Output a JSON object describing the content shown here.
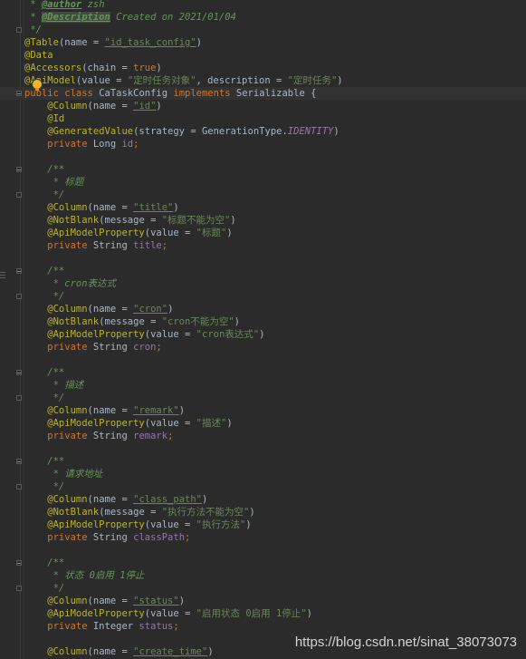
{
  "editor": {
    "lines": [
      {
        "fold": "",
        "current": false,
        "tokens": [
          {
            "t": " * ",
            "c": "c-comment"
          },
          {
            "t": "@author",
            "c": "c-tag"
          },
          {
            "t": " zsh",
            "c": "c-comment"
          }
        ]
      },
      {
        "fold": "",
        "current": false,
        "tokens": [
          {
            "t": " * ",
            "c": "c-comment"
          },
          {
            "t": "@Description",
            "c": "c-tag c-tag-hl"
          },
          {
            "t": " Created on 2021/01/04",
            "c": "c-comment"
          }
        ]
      },
      {
        "fold": "close",
        "current": false,
        "tokens": [
          {
            "t": " */",
            "c": "c-comment"
          }
        ]
      },
      {
        "fold": "",
        "current": false,
        "tokens": [
          {
            "t": "@Table",
            "c": "c-anno"
          },
          {
            "t": "(name = ",
            "c": "c-plain"
          },
          {
            "t": "\"id_task_config\"",
            "c": "c-str-u"
          },
          {
            "t": ")",
            "c": "c-plain"
          }
        ]
      },
      {
        "fold": "",
        "current": false,
        "tokens": [
          {
            "t": "@Data",
            "c": "c-anno"
          }
        ]
      },
      {
        "fold": "",
        "current": false,
        "tokens": [
          {
            "t": "@Accessors",
            "c": "c-anno"
          },
          {
            "t": "(chain = ",
            "c": "c-plain"
          },
          {
            "t": "true",
            "c": "c-kw"
          },
          {
            "t": ")",
            "c": "c-plain"
          }
        ]
      },
      {
        "fold": "",
        "current": false,
        "tokens": [
          {
            "t": "@ApiModel",
            "c": "c-anno"
          },
          {
            "t": "(value = ",
            "c": "c-plain"
          },
          {
            "t": "\"定时任务对象\"",
            "c": "c-str"
          },
          {
            "t": ", description = ",
            "c": "c-plain"
          },
          {
            "t": "\"定时任务\"",
            "c": "c-str"
          },
          {
            "t": ")",
            "c": "c-plain"
          }
        ]
      },
      {
        "fold": "open",
        "current": true,
        "tokens": [
          {
            "t": "public class ",
            "c": "c-kw"
          },
          {
            "t": "CaTaskConfig",
            "c": "c-cls"
          },
          {
            "t": " implements ",
            "c": "c-kw"
          },
          {
            "t": "Serializable {",
            "c": "c-plain"
          }
        ]
      },
      {
        "fold": "",
        "current": false,
        "tokens": [
          {
            "t": "    @Column",
            "c": "c-anno"
          },
          {
            "t": "(name = ",
            "c": "c-plain"
          },
          {
            "t": "\"id\"",
            "c": "c-str-u"
          },
          {
            "t": ")",
            "c": "c-plain"
          }
        ]
      },
      {
        "fold": "",
        "current": false,
        "tokens": [
          {
            "t": "    @Id",
            "c": "c-anno"
          }
        ]
      },
      {
        "fold": "",
        "current": false,
        "tokens": [
          {
            "t": "    @GeneratedValue",
            "c": "c-anno"
          },
          {
            "t": "(strategy = GenerationType.",
            "c": "c-plain"
          },
          {
            "t": "IDENTITY",
            "c": "c-const"
          },
          {
            "t": ")",
            "c": "c-plain"
          }
        ]
      },
      {
        "fold": "",
        "current": false,
        "tokens": [
          {
            "t": "    private ",
            "c": "c-kw"
          },
          {
            "t": "Long ",
            "c": "c-plain"
          },
          {
            "t": "id",
            "c": "c-field"
          },
          {
            "t": ";",
            "c": "c-kw"
          }
        ]
      },
      {
        "fold": "",
        "current": false,
        "tokens": []
      },
      {
        "fold": "open",
        "current": false,
        "tokens": [
          {
            "t": "    /**",
            "c": "c-comment"
          }
        ]
      },
      {
        "fold": "",
        "current": false,
        "tokens": [
          {
            "t": "     * 标题",
            "c": "c-comment"
          }
        ]
      },
      {
        "fold": "close",
        "current": false,
        "tokens": [
          {
            "t": "     */",
            "c": "c-comment"
          }
        ]
      },
      {
        "fold": "",
        "current": false,
        "tokens": [
          {
            "t": "    @Column",
            "c": "c-anno"
          },
          {
            "t": "(name = ",
            "c": "c-plain"
          },
          {
            "t": "\"title\"",
            "c": "c-str-u"
          },
          {
            "t": ")",
            "c": "c-plain"
          }
        ]
      },
      {
        "fold": "",
        "current": false,
        "tokens": [
          {
            "t": "    @NotBlank",
            "c": "c-anno"
          },
          {
            "t": "(message = ",
            "c": "c-plain"
          },
          {
            "t": "\"标题不能为空\"",
            "c": "c-str"
          },
          {
            "t": ")",
            "c": "c-plain"
          }
        ]
      },
      {
        "fold": "",
        "current": false,
        "tokens": [
          {
            "t": "    @ApiModelProperty",
            "c": "c-anno"
          },
          {
            "t": "(value = ",
            "c": "c-plain"
          },
          {
            "t": "\"标题\"",
            "c": "c-str"
          },
          {
            "t": ")",
            "c": "c-plain"
          }
        ]
      },
      {
        "fold": "",
        "current": false,
        "tokens": [
          {
            "t": "    private ",
            "c": "c-kw"
          },
          {
            "t": "String ",
            "c": "c-plain"
          },
          {
            "t": "title",
            "c": "c-field"
          },
          {
            "t": ";",
            "c": "c-kw"
          }
        ]
      },
      {
        "fold": "",
        "current": false,
        "tokens": []
      },
      {
        "fold": "open",
        "current": false,
        "tokens": [
          {
            "t": "    /**",
            "c": "c-comment"
          }
        ]
      },
      {
        "fold": "",
        "current": false,
        "tokens": [
          {
            "t": "     * cron表达式",
            "c": "c-comment"
          }
        ]
      },
      {
        "fold": "close",
        "current": false,
        "tokens": [
          {
            "t": "     */",
            "c": "c-comment"
          }
        ]
      },
      {
        "fold": "",
        "current": false,
        "tokens": [
          {
            "t": "    @Column",
            "c": "c-anno"
          },
          {
            "t": "(name = ",
            "c": "c-plain"
          },
          {
            "t": "\"cron\"",
            "c": "c-str-u"
          },
          {
            "t": ")",
            "c": "c-plain"
          }
        ]
      },
      {
        "fold": "",
        "current": false,
        "tokens": [
          {
            "t": "    @NotBlank",
            "c": "c-anno"
          },
          {
            "t": "(message = ",
            "c": "c-plain"
          },
          {
            "t": "\"cron不能为空\"",
            "c": "c-str"
          },
          {
            "t": ")",
            "c": "c-plain"
          }
        ]
      },
      {
        "fold": "",
        "current": false,
        "tokens": [
          {
            "t": "    @ApiModelProperty",
            "c": "c-anno"
          },
          {
            "t": "(value = ",
            "c": "c-plain"
          },
          {
            "t": "\"cron表达式\"",
            "c": "c-str"
          },
          {
            "t": ")",
            "c": "c-plain"
          }
        ]
      },
      {
        "fold": "",
        "current": false,
        "tokens": [
          {
            "t": "    private ",
            "c": "c-kw"
          },
          {
            "t": "String ",
            "c": "c-plain"
          },
          {
            "t": "cron",
            "c": "c-field"
          },
          {
            "t": ";",
            "c": "c-kw"
          }
        ]
      },
      {
        "fold": "",
        "current": false,
        "tokens": []
      },
      {
        "fold": "open",
        "current": false,
        "tokens": [
          {
            "t": "    /**",
            "c": "c-comment"
          }
        ]
      },
      {
        "fold": "",
        "current": false,
        "tokens": [
          {
            "t": "     * 描述",
            "c": "c-comment"
          }
        ]
      },
      {
        "fold": "close",
        "current": false,
        "tokens": [
          {
            "t": "     */",
            "c": "c-comment"
          }
        ]
      },
      {
        "fold": "",
        "current": false,
        "tokens": [
          {
            "t": "    @Column",
            "c": "c-anno"
          },
          {
            "t": "(name = ",
            "c": "c-plain"
          },
          {
            "t": "\"remark\"",
            "c": "c-str-u"
          },
          {
            "t": ")",
            "c": "c-plain"
          }
        ]
      },
      {
        "fold": "",
        "current": false,
        "tokens": [
          {
            "t": "    @ApiModelProperty",
            "c": "c-anno"
          },
          {
            "t": "(value = ",
            "c": "c-plain"
          },
          {
            "t": "\"描述\"",
            "c": "c-str"
          },
          {
            "t": ")",
            "c": "c-plain"
          }
        ]
      },
      {
        "fold": "",
        "current": false,
        "tokens": [
          {
            "t": "    private ",
            "c": "c-kw"
          },
          {
            "t": "String ",
            "c": "c-plain"
          },
          {
            "t": "remark",
            "c": "c-field"
          },
          {
            "t": ";",
            "c": "c-kw"
          }
        ]
      },
      {
        "fold": "",
        "current": false,
        "tokens": []
      },
      {
        "fold": "open",
        "current": false,
        "tokens": [
          {
            "t": "    /**",
            "c": "c-comment"
          }
        ]
      },
      {
        "fold": "",
        "current": false,
        "tokens": [
          {
            "t": "     * 请求地址",
            "c": "c-comment"
          }
        ]
      },
      {
        "fold": "close",
        "current": false,
        "tokens": [
          {
            "t": "     */",
            "c": "c-comment"
          }
        ]
      },
      {
        "fold": "",
        "current": false,
        "tokens": [
          {
            "t": "    @Column",
            "c": "c-anno"
          },
          {
            "t": "(name = ",
            "c": "c-plain"
          },
          {
            "t": "\"class_path\"",
            "c": "c-str-u"
          },
          {
            "t": ")",
            "c": "c-plain"
          }
        ]
      },
      {
        "fold": "",
        "current": false,
        "tokens": [
          {
            "t": "    @NotBlank",
            "c": "c-anno"
          },
          {
            "t": "(message = ",
            "c": "c-plain"
          },
          {
            "t": "\"执行方法不能为空\"",
            "c": "c-str"
          },
          {
            "t": ")",
            "c": "c-plain"
          }
        ]
      },
      {
        "fold": "",
        "current": false,
        "tokens": [
          {
            "t": "    @ApiModelProperty",
            "c": "c-anno"
          },
          {
            "t": "(value = ",
            "c": "c-plain"
          },
          {
            "t": "\"执行方法\"",
            "c": "c-str"
          },
          {
            "t": ")",
            "c": "c-plain"
          }
        ]
      },
      {
        "fold": "",
        "current": false,
        "tokens": [
          {
            "t": "    private ",
            "c": "c-kw"
          },
          {
            "t": "String ",
            "c": "c-plain"
          },
          {
            "t": "classPath",
            "c": "c-field"
          },
          {
            "t": ";",
            "c": "c-kw"
          }
        ]
      },
      {
        "fold": "",
        "current": false,
        "tokens": []
      },
      {
        "fold": "open",
        "current": false,
        "tokens": [
          {
            "t": "    /**",
            "c": "c-comment"
          }
        ]
      },
      {
        "fold": "",
        "current": false,
        "tokens": [
          {
            "t": "     * 状态 0启用 1停止",
            "c": "c-comment"
          }
        ]
      },
      {
        "fold": "close",
        "current": false,
        "tokens": [
          {
            "t": "     */",
            "c": "c-comment"
          }
        ]
      },
      {
        "fold": "",
        "current": false,
        "tokens": [
          {
            "t": "    @Column",
            "c": "c-anno"
          },
          {
            "t": "(name = ",
            "c": "c-plain"
          },
          {
            "t": "\"status\"",
            "c": "c-str-u"
          },
          {
            "t": ")",
            "c": "c-plain"
          }
        ]
      },
      {
        "fold": "",
        "current": false,
        "tokens": [
          {
            "t": "    @ApiModelProperty",
            "c": "c-anno"
          },
          {
            "t": "(value = ",
            "c": "c-plain"
          },
          {
            "t": "\"启用状态 0启用 1停止\"",
            "c": "c-str"
          },
          {
            "t": ")",
            "c": "c-plain"
          }
        ]
      },
      {
        "fold": "",
        "current": false,
        "tokens": [
          {
            "t": "    private ",
            "c": "c-kw"
          },
          {
            "t": "Integer ",
            "c": "c-plain"
          },
          {
            "t": "status",
            "c": "c-field"
          },
          {
            "t": ";",
            "c": "c-kw"
          }
        ]
      },
      {
        "fold": "",
        "current": false,
        "tokens": []
      },
      {
        "fold": "",
        "current": false,
        "tokens": [
          {
            "t": "    @Column",
            "c": "c-anno"
          },
          {
            "t": "(name = ",
            "c": "c-plain"
          },
          {
            "t": "\"create_time\"",
            "c": "c-str-u"
          },
          {
            "t": ")",
            "c": "c-plain"
          }
        ]
      }
    ]
  },
  "watermark": "https://blog.csdn.net/sinat_38073073",
  "icons": {
    "bulb": "lightbulb-icon",
    "fold": "fold-marker-icon"
  },
  "colors": {
    "background": "#2b2b2b",
    "keyword": "#cc7832",
    "annotation": "#bbb529",
    "string": "#6a8759",
    "comment": "#629755",
    "field": "#9876aa",
    "text": "#a9b7c6"
  }
}
